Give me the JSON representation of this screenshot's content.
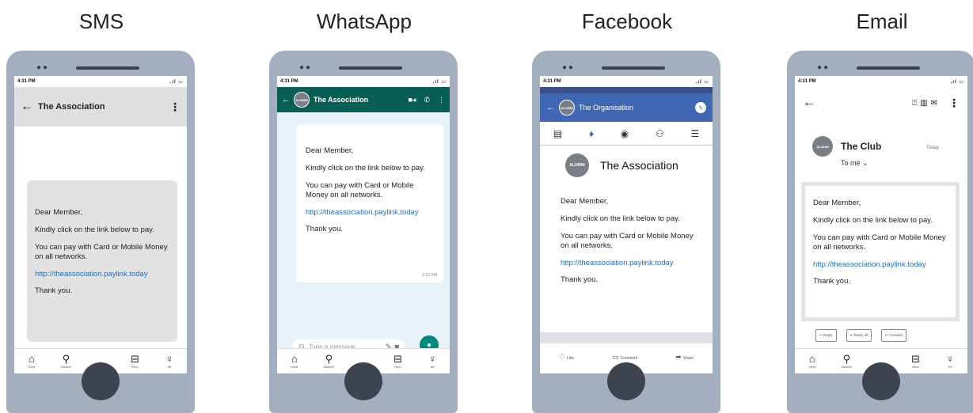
{
  "columns": {
    "sms": "SMS",
    "whatsapp": "WhatsApp",
    "facebook": "Facebook",
    "email": "Email"
  },
  "status": {
    "time": "4:31 PM"
  },
  "message": {
    "greeting": "Dear Member,",
    "line1": "Kindly click on the link below to pay.",
    "line2": "You can pay with Card or Mobile Money on all networks.",
    "link": "http://theassociation.paylink.today",
    "closing": "Thank you."
  },
  "avatar_text": "ALUMNI",
  "sms": {
    "title": "The Association"
  },
  "whatsapp": {
    "title": "The Association",
    "time": "5:22 PM",
    "input_placeholder": "Type a message"
  },
  "facebook": {
    "header_title": "The Organisation",
    "profile_name": "The Association",
    "actions": {
      "like": "Like",
      "comment": "Comment",
      "share": "Share"
    }
  },
  "email": {
    "sender": "The Club",
    "date": "Today",
    "to": "To me",
    "buttons": {
      "reply": "Reply",
      "reply_all": "Reply All",
      "forward": "Forward"
    }
  },
  "nav": {
    "home": "Home",
    "discover": "Discover",
    "inbox": "Inbox",
    "me": "Me"
  },
  "colors": {
    "phone_body": "#a3afbf",
    "whatsapp_green": "#075e54",
    "facebook_blue": "#4267b2",
    "link": "#2a6db5"
  }
}
